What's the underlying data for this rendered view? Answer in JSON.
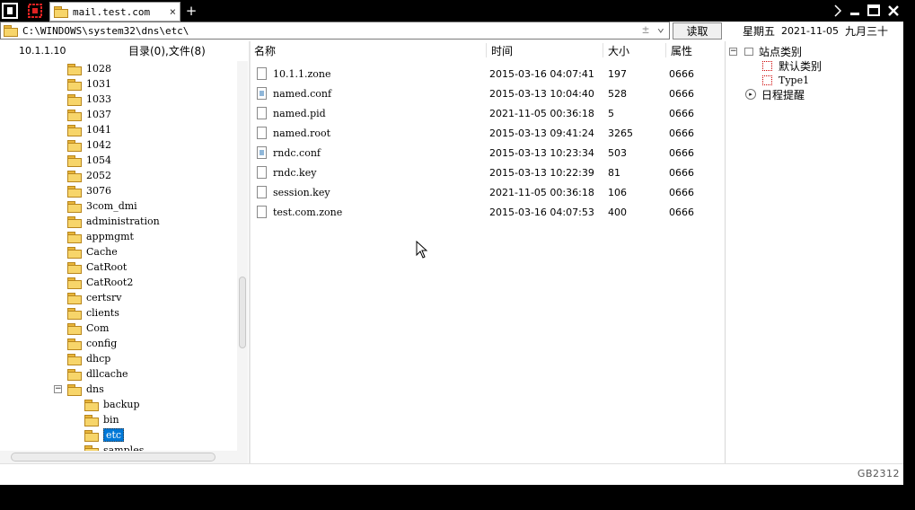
{
  "titlebar": {
    "tab_title": "mail.test.com",
    "new_tab": "+",
    "close_tab": "×"
  },
  "toolbar": {
    "path": "C:\\WINDOWS\\system32\\dns\\etc\\",
    "path_plus": "±",
    "path_dropdown": "⌄",
    "read_button": "读取",
    "weekday": "星期五",
    "date": "2021-11-05",
    "lunar": "九月三十"
  },
  "tree_header": {
    "host": "10.1.1.10",
    "summary": "目录(0),文件(8)"
  },
  "tree": {
    "items": [
      {
        "name": "1028",
        "level": 1
      },
      {
        "name": "1031",
        "level": 1
      },
      {
        "name": "1033",
        "level": 1
      },
      {
        "name": "1037",
        "level": 1
      },
      {
        "name": "1041",
        "level": 1
      },
      {
        "name": "1042",
        "level": 1
      },
      {
        "name": "1054",
        "level": 1
      },
      {
        "name": "2052",
        "level": 1
      },
      {
        "name": "3076",
        "level": 1
      },
      {
        "name": "3com_dmi",
        "level": 1
      },
      {
        "name": "administration",
        "level": 1
      },
      {
        "name": "appmgmt",
        "level": 1
      },
      {
        "name": "Cache",
        "level": 1
      },
      {
        "name": "CatRoot",
        "level": 1
      },
      {
        "name": "CatRoot2",
        "level": 1
      },
      {
        "name": "certsrv",
        "level": 1
      },
      {
        "name": "clients",
        "level": 1
      },
      {
        "name": "Com",
        "level": 1
      },
      {
        "name": "config",
        "level": 1
      },
      {
        "name": "dhcp",
        "level": 1
      },
      {
        "name": "dllcache",
        "level": 1
      },
      {
        "name": "dns",
        "level": 1,
        "expanded": true
      },
      {
        "name": "backup",
        "level": 2
      },
      {
        "name": "bin",
        "level": 2
      },
      {
        "name": "etc",
        "level": 2,
        "selected": true
      },
      {
        "name": "samples",
        "level": 2
      }
    ]
  },
  "file_list": {
    "columns": {
      "name": "名称",
      "time": "时间",
      "size": "大小",
      "attr": "属性"
    },
    "rows": [
      {
        "name": "10.1.1.zone",
        "time": "2015-03-16 04:07:41",
        "size": "197",
        "attr": "0666",
        "icon": "file-icon"
      },
      {
        "name": "named.conf",
        "time": "2015-03-13 10:04:40",
        "size": "528",
        "attr": "0666",
        "icon": "config-file-icon"
      },
      {
        "name": "named.pid",
        "time": "2021-11-05 00:36:18",
        "size": "5",
        "attr": "0666",
        "icon": "file-icon"
      },
      {
        "name": "named.root",
        "time": "2015-03-13 09:41:24",
        "size": "3265",
        "attr": "0666",
        "icon": "file-icon"
      },
      {
        "name": "rndc.conf",
        "time": "2015-03-13 10:23:34",
        "size": "503",
        "attr": "0666",
        "icon": "config-file-icon"
      },
      {
        "name": "rndc.key",
        "time": "2015-03-13 10:22:39",
        "size": "81",
        "attr": "0666",
        "icon": "file-icon"
      },
      {
        "name": "session.key",
        "time": "2021-11-05 00:36:18",
        "size": "106",
        "attr": "0666",
        "icon": "file-icon"
      },
      {
        "name": "test.com.zone",
        "time": "2015-03-16 04:07:53",
        "size": "400",
        "attr": "0666",
        "icon": "file-icon"
      }
    ]
  },
  "right_panel": {
    "site_category": "站点类别",
    "default_category": "默认类别",
    "type1": "Type1",
    "schedule": "日程提醒"
  },
  "status": {
    "encoding": "GB2312"
  },
  "colors": {
    "selection": "#0078d7",
    "folder": "#f7d56a",
    "background": "#000000"
  }
}
